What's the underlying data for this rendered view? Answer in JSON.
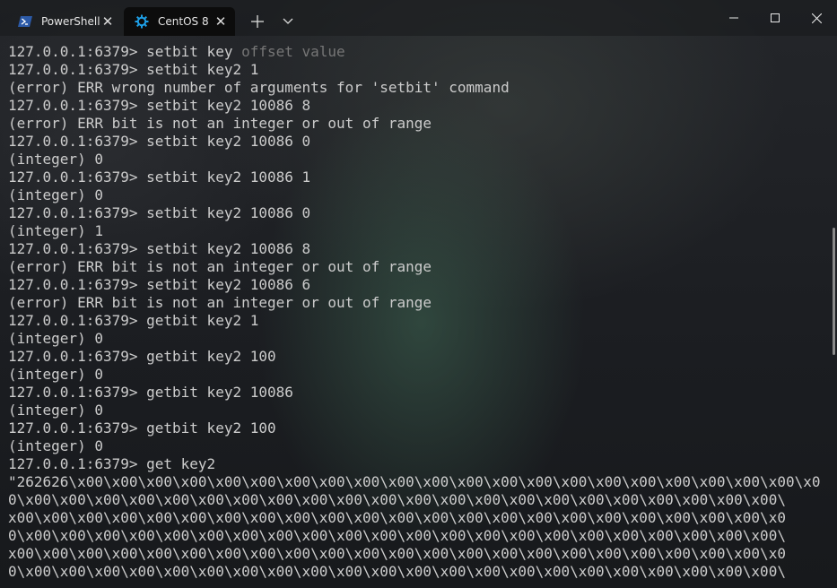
{
  "tabs": [
    {
      "label": "PowerShell",
      "active": false,
      "icon": "powershell-icon"
    },
    {
      "label": "CentOS 8",
      "active": true,
      "icon": "centos-icon"
    }
  ],
  "colors": {
    "terminal_text": "#cccccc",
    "hint_text": "#767676",
    "active_tab_bg": "#0c0c0c",
    "powershell_icon": "#2c5aa8",
    "centos_icon": "#1ea0e8"
  },
  "terminal": {
    "lines": [
      "127.0.0.1:6379> setbit key ",
      "127.0.0.1:6379> setbit key2 1",
      "(error) ERR wrong number of arguments for 'setbit' command",
      "127.0.0.1:6379> setbit key2 10086 8",
      "(error) ERR bit is not an integer or out of range",
      "127.0.0.1:6379> setbit key2 10086 0",
      "(integer) 0",
      "127.0.0.1:6379> setbit key2 10086 1",
      "(integer) 0",
      "127.0.0.1:6379> setbit key2 10086 0",
      "(integer) 1",
      "127.0.0.1:6379> setbit key2 10086 8",
      "(error) ERR bit is not an integer or out of range",
      "127.0.0.1:6379> setbit key2 10086 6",
      "(error) ERR bit is not an integer or out of range",
      "127.0.0.1:6379> getbit key2 1",
      "(integer) 0",
      "127.0.0.1:6379> getbit key2 100",
      "(integer) 0",
      "127.0.0.1:6379> getbit key2 10086",
      "(integer) 0",
      "127.0.0.1:6379> getbit key2 100",
      "(integer) 0",
      "127.0.0.1:6379> get key2",
      "\"262626\\x00\\x00\\x00\\x00\\x00\\x00\\x00\\x00\\x00\\x00\\x00\\x00\\x00\\x00\\x00\\x00\\x00\\x00\\x00\\x00\\x00\\x0",
      "0\\x00\\x00\\x00\\x00\\x00\\x00\\x00\\x00\\x00\\x00\\x00\\x00\\x00\\x00\\x00\\x00\\x00\\x00\\x00\\x00\\x00\\x00\\",
      "x00\\x00\\x00\\x00\\x00\\x00\\x00\\x00\\x00\\x00\\x00\\x00\\x00\\x00\\x00\\x00\\x00\\x00\\x00\\x00\\x00\\x00\\x0",
      "0\\x00\\x00\\x00\\x00\\x00\\x00\\x00\\x00\\x00\\x00\\x00\\x00\\x00\\x00\\x00\\x00\\x00\\x00\\x00\\x00\\x00\\x00\\",
      "x00\\x00\\x00\\x00\\x00\\x00\\x00\\x00\\x00\\x00\\x00\\x00\\x00\\x00\\x00\\x00\\x00\\x00\\x00\\x00\\x00\\x00\\x0",
      "0\\x00\\x00\\x00\\x00\\x00\\x00\\x00\\x00\\x00\\x00\\x00\\x00\\x00\\x00\\x00\\x00\\x00\\x00\\x00\\x00\\x00\\x00\\"
    ],
    "first_line_hint": "offset value"
  }
}
